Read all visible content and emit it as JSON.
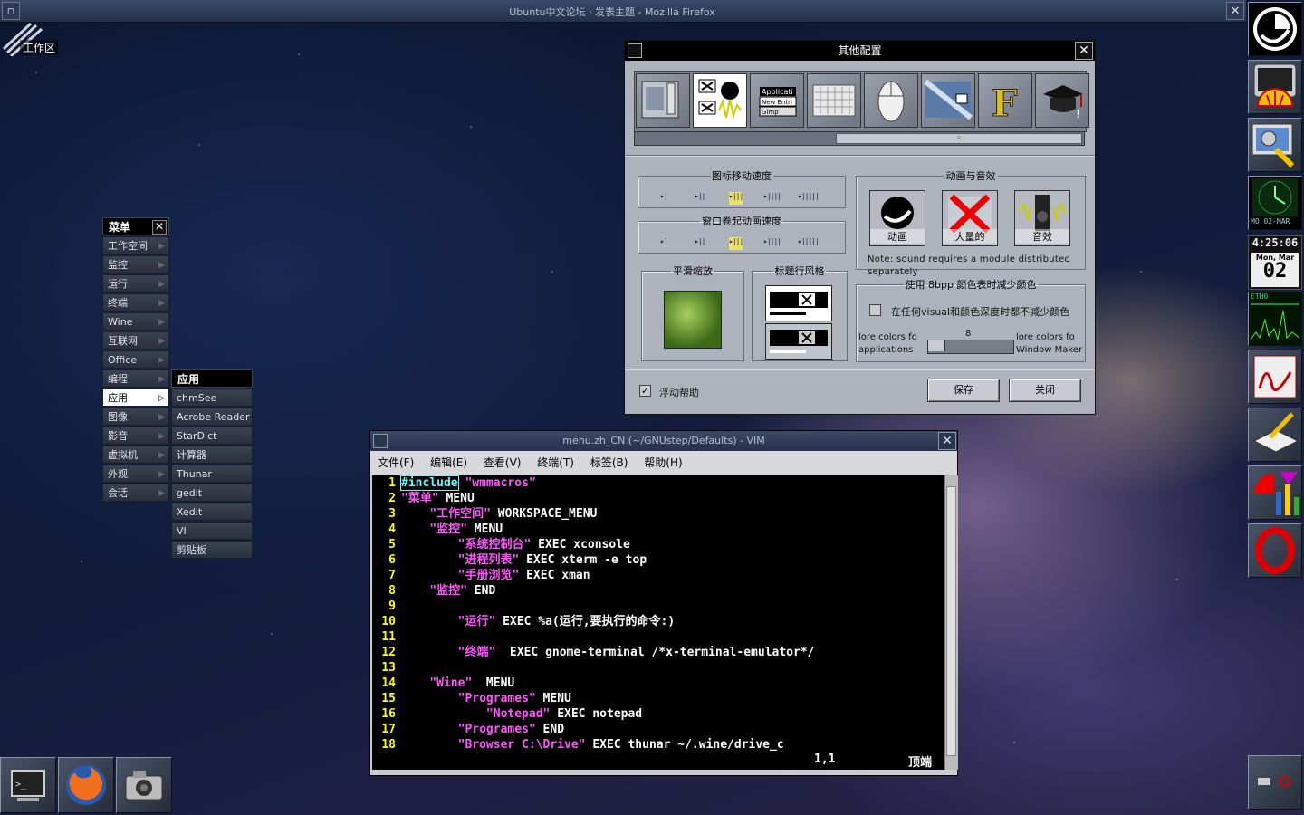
{
  "browser": {
    "title": "Ubuntu中文论坛 · 发表主题 - Mozilla Firefox"
  },
  "workspace": {
    "label": "工作区"
  },
  "dock": {
    "clock_strip": "MO 02-MAR",
    "time": "4:25:06",
    "day": "Mon, Mar",
    "date": "02",
    "net_label": "ETH0"
  },
  "menu": {
    "title": "菜单",
    "items": [
      "工作空间",
      "监控",
      "运行",
      "终端",
      "Wine",
      "互联网",
      "Office",
      "编程",
      "应用",
      "图像",
      "影音",
      "虚拟机",
      "外观",
      "会话"
    ],
    "selected": "应用"
  },
  "submenu": {
    "title": "应用",
    "items": [
      "chmSee",
      "Acrobe Reader",
      "StarDict",
      "计算器",
      "Thunar",
      "gedit",
      "Xedit",
      "VI",
      "剪贴板"
    ]
  },
  "prefs": {
    "title": "其他配置",
    "icon_move_speed": "图标移动速度",
    "shade_speed": "窗口卷起动画速度",
    "anim_sound": "动画与音效",
    "anim_label": "动画",
    "superfluous_label": "大量的",
    "sound_label": "音效",
    "note": "Note: sound requires a module distributed separately",
    "smooth_scale": "平滑缩放",
    "titlebar_style": "标题行风格",
    "bpp_group": "使用 8bpp 颜色表时减少颜色",
    "bpp_check": "在任何visual和颜色深度时都不减少颜色",
    "slider_left": "lore colors fo applications",
    "slider_value": "8",
    "slider_right": "lore colors fo Window Maker",
    "balloon_help": "浮动帮助",
    "save": "保存",
    "close": "关闭",
    "icon_applications_text": [
      "Applicati",
      "New Entri",
      "Gimp"
    ]
  },
  "vim": {
    "title": "menu.zh_CN (~/GNUstep/Defaults) - VIM",
    "menus": [
      "文件(F)",
      "编辑(E)",
      "查看(V)",
      "终端(T)",
      "标签(B)",
      "帮助(H)"
    ],
    "lines": [
      {
        "n": "1",
        "indent": "",
        "str": "",
        "tail": "",
        "pp": "#include",
        "inc": " \"wmmacros\""
      },
      {
        "n": "2",
        "indent": "",
        "str": "\"菜单\"",
        "tail": " MENU"
      },
      {
        "n": "3",
        "indent": "    ",
        "str": "\"工作空间\"",
        "tail": " WORKSPACE_MENU"
      },
      {
        "n": "4",
        "indent": "    ",
        "str": "\"监控\"",
        "tail": " MENU"
      },
      {
        "n": "5",
        "indent": "        ",
        "str": "\"系统控制台\"",
        "tail": " EXEC xconsole"
      },
      {
        "n": "6",
        "indent": "        ",
        "str": "\"进程列表\"",
        "tail": " EXEC xterm -e top"
      },
      {
        "n": "7",
        "indent": "        ",
        "str": "\"手册浏览\"",
        "tail": " EXEC xman"
      },
      {
        "n": "8",
        "indent": "    ",
        "str": "\"监控\"",
        "tail": " END"
      },
      {
        "n": "9",
        "indent": "",
        "str": "",
        "tail": ""
      },
      {
        "n": "10",
        "indent": "        ",
        "str": "\"运行\"",
        "tail": " EXEC %a(运行,要执行的命令:)"
      },
      {
        "n": "11",
        "indent": "",
        "str": "",
        "tail": ""
      },
      {
        "n": "12",
        "indent": "        ",
        "str": "\"终端\"",
        "tail": "  EXEC gnome-terminal /*x-terminal-emulator*/"
      },
      {
        "n": "13",
        "indent": "",
        "str": "",
        "tail": ""
      },
      {
        "n": "14",
        "indent": "    ",
        "str": "\"Wine\"",
        "tail": "  MENU"
      },
      {
        "n": "15",
        "indent": "        ",
        "str": "\"Programes\"",
        "tail": " MENU"
      },
      {
        "n": "16",
        "indent": "            ",
        "str": "\"Notepad\"",
        "tail": " EXEC notepad"
      },
      {
        "n": "17",
        "indent": "        ",
        "str": "\"Programes\"",
        "tail": " END"
      },
      {
        "n": "18",
        "indent": "        ",
        "str": "\"Browser C:\\Drive\"",
        "tail": " EXEC thunar ~/.wine/drive_c"
      }
    ],
    "position": "1,1",
    "scroll_pos": "顶端"
  },
  "colors": {
    "vim_linenr": "#ffff00",
    "vim_string": "#ff55ff",
    "vim_include": "#55ffff",
    "menu_selected": "#ffffff"
  }
}
